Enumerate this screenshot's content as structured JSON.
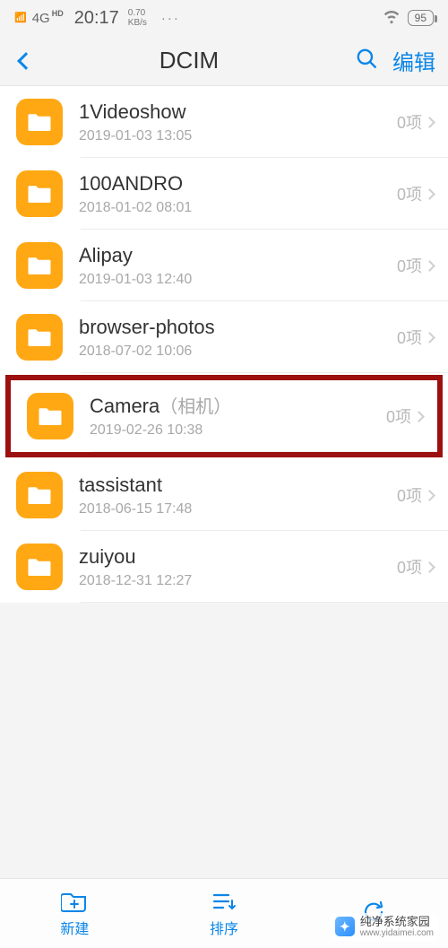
{
  "status": {
    "signal": "4G",
    "hd": "HD",
    "time": "20:17",
    "speed_top": "0.70",
    "speed_bottom": "KB/s",
    "more": "···",
    "battery": "95"
  },
  "nav": {
    "title": "DCIM",
    "edit_label": "编辑"
  },
  "folders": [
    {
      "name": "1Videoshow",
      "suffix": "",
      "date": "2019-01-03 13:05",
      "count": "0项",
      "highlight": false
    },
    {
      "name": "100ANDRO",
      "suffix": "",
      "date": "2018-01-02 08:01",
      "count": "0项",
      "highlight": false
    },
    {
      "name": "Alipay",
      "suffix": "",
      "date": "2019-01-03 12:40",
      "count": "0项",
      "highlight": false
    },
    {
      "name": "browser-photos",
      "suffix": "",
      "date": "2018-07-02 10:06",
      "count": "0项",
      "highlight": false
    },
    {
      "name": "Camera",
      "suffix": "（相机）",
      "date": "2019-02-26 10:38",
      "count": "0项",
      "highlight": true
    },
    {
      "name": "tassistant",
      "suffix": "",
      "date": "2018-06-15 17:48",
      "count": "0项",
      "highlight": false
    },
    {
      "name": "zuiyou",
      "suffix": "",
      "date": "2018-12-31 12:27",
      "count": "0项",
      "highlight": false
    }
  ],
  "toolbar": {
    "new_label": "新建",
    "sort_label": "排序",
    "refresh_label": ""
  },
  "watermark": {
    "title": "纯净系统家园",
    "url": "www.yidaimei.com"
  }
}
